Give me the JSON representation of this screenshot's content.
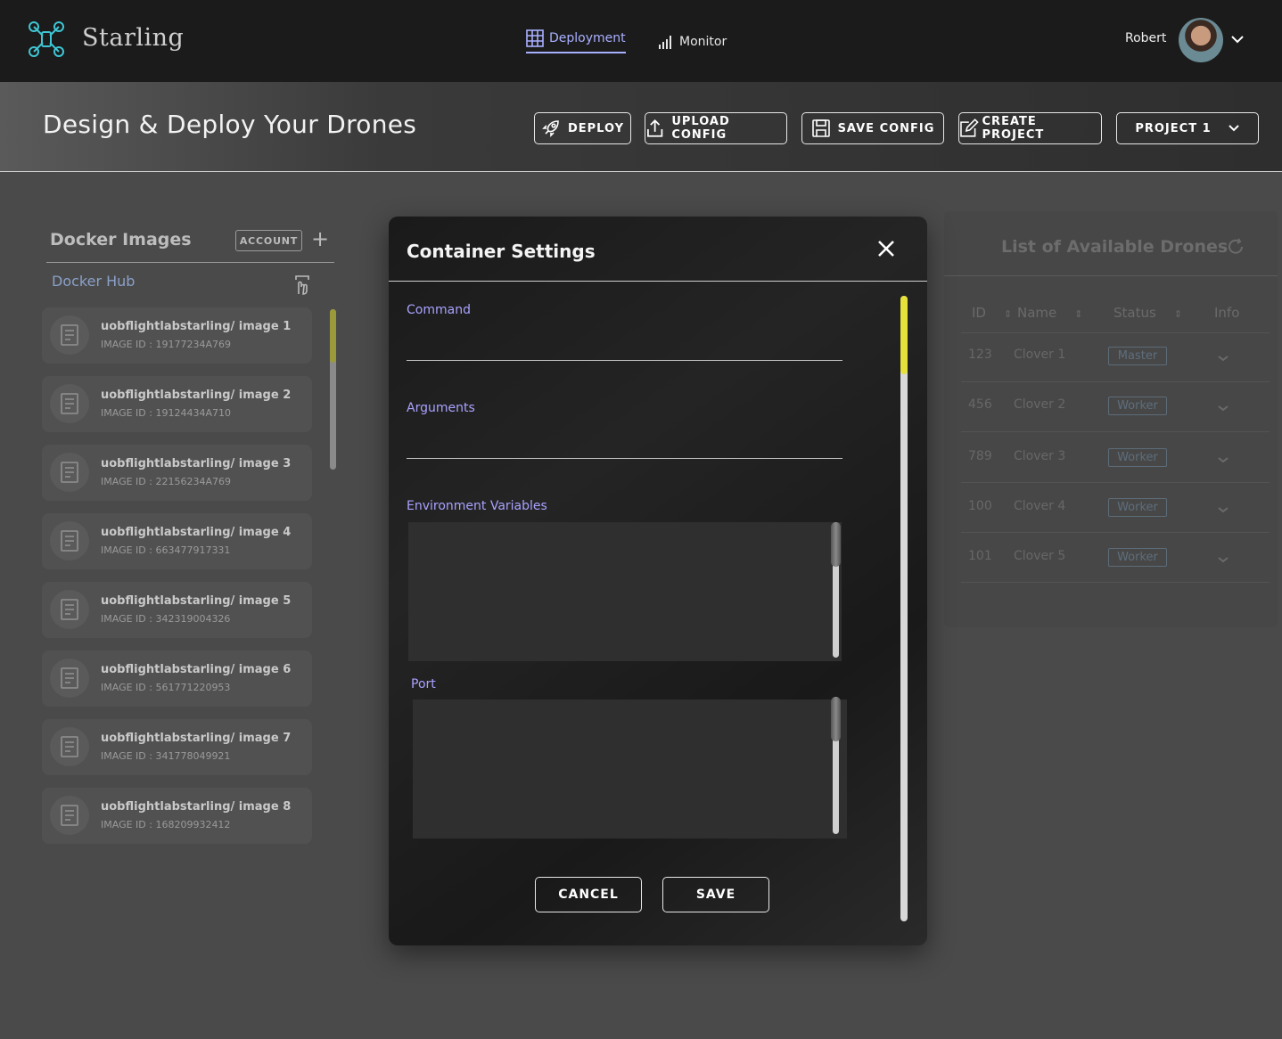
{
  "app": {
    "name": "Starling"
  },
  "nav": {
    "deployment": "Deployment",
    "monitor": "Monitor"
  },
  "user": {
    "name": "Robert"
  },
  "page": {
    "title": "Design & Deploy Your Drones"
  },
  "toolbar": {
    "deploy": "DEPLOY",
    "upload": "UPLOAD CONFIG",
    "save": "SAVE CONFIG",
    "create": "CREATE PROJECT",
    "project": "PROJECT 1"
  },
  "docker": {
    "title": "Docker Images",
    "account": "ACCOUNT",
    "hub": "Docker Hub",
    "images": [
      {
        "name": "uobflightlabstarling/ image 1",
        "id": "IMAGE ID : 19177234A769"
      },
      {
        "name": "uobflightlabstarling/ image 2",
        "id": "IMAGE ID : 19124434A710"
      },
      {
        "name": "uobflightlabstarling/ image 3",
        "id": "IMAGE ID : 22156234A769"
      },
      {
        "name": "uobflightlabstarling/ image 4",
        "id": "IMAGE ID : 663477917331"
      },
      {
        "name": "uobflightlabstarling/ image 5",
        "id": "IMAGE ID : 342319004326"
      },
      {
        "name": "uobflightlabstarling/ image 6",
        "id": "IMAGE ID : 561771220953"
      },
      {
        "name": "uobflightlabstarling/ image 7",
        "id": "IMAGE ID : 341778049921"
      },
      {
        "name": "uobflightlabstarling/ image 8",
        "id": "IMAGE ID : 168209932412"
      }
    ]
  },
  "drones": {
    "title": "List of Available Drones",
    "headers": {
      "id": "ID",
      "name": "Name",
      "status": "Status",
      "info": "Info"
    },
    "rows": [
      {
        "id": "123",
        "name": "Clover 1",
        "status": "Master"
      },
      {
        "id": "456",
        "name": "Clover 2",
        "status": "Worker"
      },
      {
        "id": "789",
        "name": "Clover 3",
        "status": "Worker"
      },
      {
        "id": "100",
        "name": "Clover 4",
        "status": "Worker"
      },
      {
        "id": "101",
        "name": "Clover 5",
        "status": "Worker"
      }
    ]
  },
  "modal": {
    "title": "Container Settings",
    "command_label": "Command",
    "command_value": "",
    "arguments_label": "Arguments",
    "arguments_value": "",
    "env_label": "Environment Variables",
    "port_label": "Port",
    "cancel": "CANCEL",
    "save": "SAVE"
  },
  "colors": {
    "accent": "#a9a2ff",
    "nav_active": "#a9b0ff",
    "scroll_thumb": "#e6e03a",
    "logo": "#3fc6d4"
  }
}
